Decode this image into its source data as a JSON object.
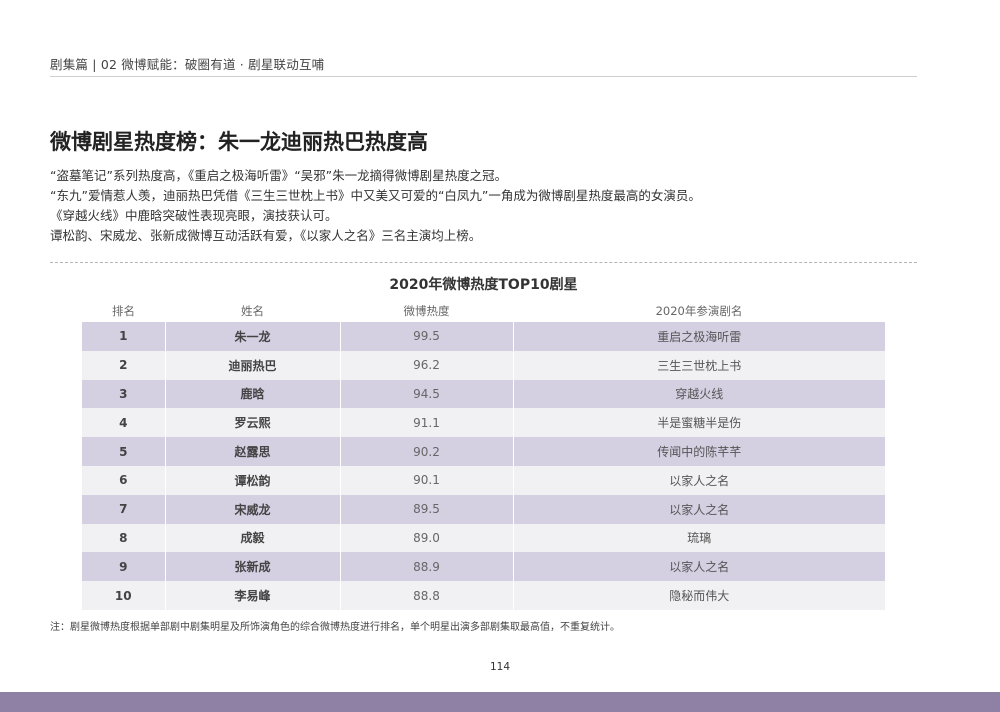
{
  "header": {
    "section": "剧集篇 | 02  微博赋能：破圈有道 · 剧星联动互哺"
  },
  "title": "微博剧星热度榜：朱一龙迪丽热巴热度高",
  "intro": [
    "“盗墓笔记”系列热度高，《重启之极海听雷》“吴邪”朱一龙摘得微博剧星热度之冠。",
    "“东九”爱情惹人羡，迪丽热巴凭借《三生三世枕上书》中又美又可爱的“白凤九”一角成为微博剧星热度最高的女演员。",
    "《穿越火线》中鹿晗突破性表现亮眼，演技获认可。",
    "谭松韵、宋威龙、张新成微博互动活跃有爱，《以家人之名》三名主演均上榜。"
  ],
  "table": {
    "title": "2020年微博热度TOP10剧星",
    "headers": [
      "排名",
      "姓名",
      "微博热度",
      "2020年参演剧名"
    ],
    "rows": [
      {
        "rank": "1",
        "name": "朱一龙",
        "score": "99.5",
        "show": "重启之极海听雷"
      },
      {
        "rank": "2",
        "name": "迪丽热巴",
        "score": "96.2",
        "show": "三生三世枕上书"
      },
      {
        "rank": "3",
        "name": "鹿晗",
        "score": "94.5",
        "show": "穿越火线"
      },
      {
        "rank": "4",
        "name": "罗云熙",
        "score": "91.1",
        "show": "半是蜜糖半是伤"
      },
      {
        "rank": "5",
        "name": "赵露思",
        "score": "90.2",
        "show": "传闻中的陈芊芊"
      },
      {
        "rank": "6",
        "name": "谭松韵",
        "score": "90.1",
        "show": "以家人之名"
      },
      {
        "rank": "7",
        "name": "宋威龙",
        "score": "89.5",
        "show": "以家人之名"
      },
      {
        "rank": "8",
        "name": "成毅",
        "score": "89.0",
        "show": "琉璃"
      },
      {
        "rank": "9",
        "name": "张新成",
        "score": "88.9",
        "show": "以家人之名"
      },
      {
        "rank": "10",
        "name": "李易峰",
        "score": "88.8",
        "show": "隐秘而伟大"
      }
    ]
  },
  "note": "注：剧星微博热度根据单部剧中剧集明星及所饰演角色的综合微博热度进行排名，单个明星出演多部剧集取最高值，不重复统计。",
  "page_number": "114",
  "colors": {
    "row_accent": "#d5cfe2",
    "row_light": "#f1f1f3",
    "band": "#8f80a6"
  }
}
